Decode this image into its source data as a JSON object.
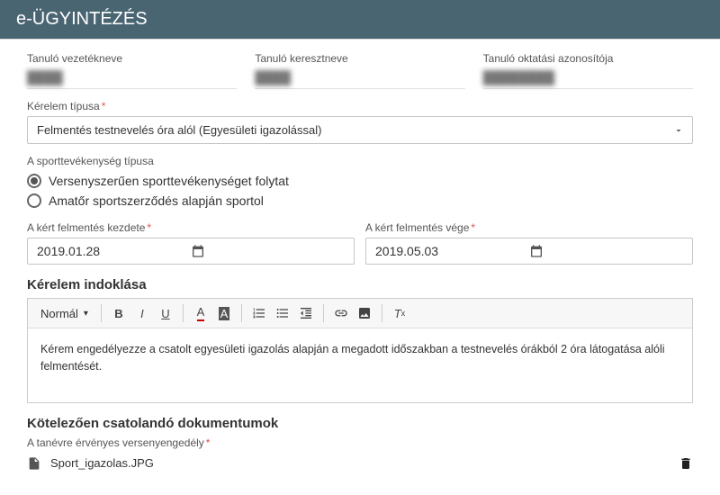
{
  "header": {
    "title": "e-ÜGYINTÉZÉS"
  },
  "student": {
    "lastname_label": "Tanuló vezetékneve",
    "lastname_value": "████",
    "firstname_label": "Tanuló keresztneve",
    "firstname_value": "████",
    "eduid_label": "Tanuló oktatási azonosítója",
    "eduid_value": "████████"
  },
  "request_type": {
    "label": "Kérelem típusa",
    "selected": "Felmentés testnevelés óra alól (Egyesületi igazolással)"
  },
  "sport_activity": {
    "label": "A sporttevékenység típusa",
    "options": [
      {
        "label": "Versenyszerűen sporttevékenységet folytat",
        "selected": true
      },
      {
        "label": "Amatőr sportszerződés alapján sportol",
        "selected": false
      }
    ]
  },
  "dates": {
    "start_label": "A kért felmentés kezdete",
    "start_value": "2019.01.28",
    "end_label": "A kért felmentés vége",
    "end_value": "2019.05.03"
  },
  "justification": {
    "title": "Kérelem indoklása",
    "format_label": "Normál",
    "text": "Kérem engedélyezze a csatolt egyesületi igazolás alapján a megadott időszakban a testnevelés órákból 2 óra látogatása alóli felmentését."
  },
  "attachments": {
    "title": "Kötelezően csatolandó dokumentumok",
    "field_label": "A tanévre érvényes versenyengedély",
    "file_name": "Sport_igazolas.JPG"
  }
}
